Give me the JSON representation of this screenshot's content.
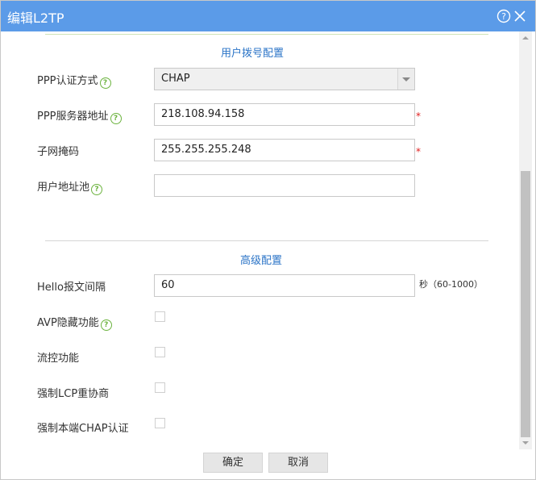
{
  "dialog": {
    "title": "编辑L2TP",
    "help_icon": "help-circle-icon",
    "close_icon": "close-icon"
  },
  "sections": {
    "dial": "用户拨号配置",
    "advanced": "高级配置"
  },
  "fields": {
    "ppp_auth": {
      "label": "PPP认证方式",
      "value": "CHAP"
    },
    "ppp_server": {
      "label": "PPP服务器地址",
      "value": "218.108.94.158",
      "required": "*"
    },
    "subnet_mask": {
      "label": "子网掩码",
      "value": "255.255.255.248",
      "required": "*"
    },
    "address_pool": {
      "label": "用户地址池",
      "value": ""
    },
    "hello_interval": {
      "label": "Hello报文间隔",
      "value": "60",
      "unit": "秒（60-1000）"
    },
    "avp_hide": {
      "label": "AVP隐藏功能"
    },
    "flow_control": {
      "label": "流控功能"
    },
    "force_lcp": {
      "label": "强制LCP重协商"
    },
    "force_chap": {
      "label": "强制本端CHAP认证"
    }
  },
  "buttons": {
    "ok": "确定",
    "cancel": "取消"
  },
  "colors": {
    "title_bar": "#5b9be8",
    "section_title": "#2b74c7",
    "help_icon": "#6cb33f",
    "required": "#e02020"
  }
}
